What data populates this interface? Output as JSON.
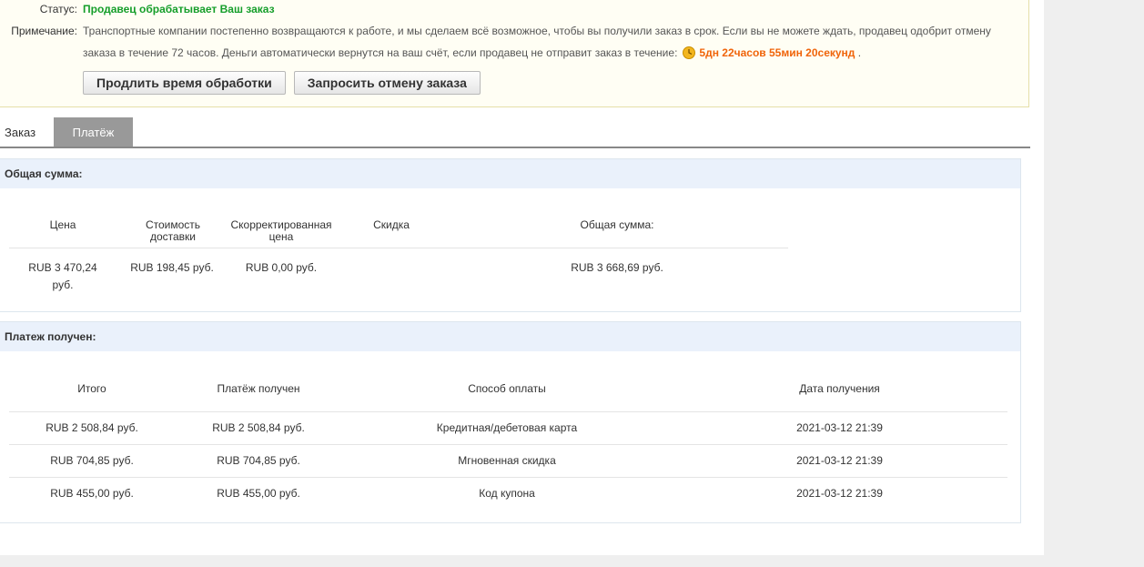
{
  "notice": {
    "status_label": "Статус:",
    "status_value": "Продавец обрабатывает Ваш заказ",
    "note_label": "Примечание:",
    "note_line1": "Транспортные компании постепенно возвращаются к работе, и мы сделаем всё возможное, чтобы вы получили заказ в срок. Если вы не можете ждать, продавец одобрит отмену",
    "note_line2": "заказа в течение 72 часов. Деньги автоматически вернутся на ваш счёт, если продавец не отправит заказ в течение:",
    "timer": "5дн 22часов 55мин 20секунд",
    "timer_suffix": ".",
    "timer_icon": "clock-icon",
    "buttons": {
      "extend": "Продлить время обработки",
      "cancel": "Запросить отмену заказа"
    }
  },
  "tabs": [
    {
      "label": "Заказ",
      "active": false
    },
    {
      "label": "Платёж",
      "active": true
    }
  ],
  "total_panel": {
    "title": "Общая сумма:",
    "headers": {
      "price": "Цена",
      "shipping": "Стоимость доставки",
      "adjusted": "Скорректированная цена",
      "discount": "Скидка",
      "total": "Общая сумма:"
    },
    "row": {
      "price": "RUB 3 470,24 руб.",
      "shipping": "RUB 198,45 руб.",
      "adjusted": "RUB 0,00 руб.",
      "discount": "",
      "total": "RUB 3 668,69 руб."
    }
  },
  "paid_panel": {
    "title": "Платеж получен:",
    "headers": {
      "amount": "Итого",
      "received": "Платёж получен",
      "method": "Способ оплаты",
      "date": "Дата получения"
    },
    "rows": [
      {
        "amount": "RUB 2 508,84 руб.",
        "received": "RUB 2 508,84 руб.",
        "method": "Кредитная/дебетовая карта",
        "date": "2021-03-12 21:39"
      },
      {
        "amount": "RUB 704,85 руб.",
        "received": "RUB 704,85 руб.",
        "method": "Мгновенная скидка",
        "date": "2021-03-12 21:39"
      },
      {
        "amount": "RUB 455,00 руб.",
        "received": "RUB 455,00 руб.",
        "method": "Код купона",
        "date": "2021-03-12 21:39"
      }
    ]
  },
  "colors": {
    "status_green": "#159e2a",
    "timer_orange": "#f0640a",
    "panel_head_bg": "#eaf1fb",
    "tab_active_bg": "#999999"
  }
}
